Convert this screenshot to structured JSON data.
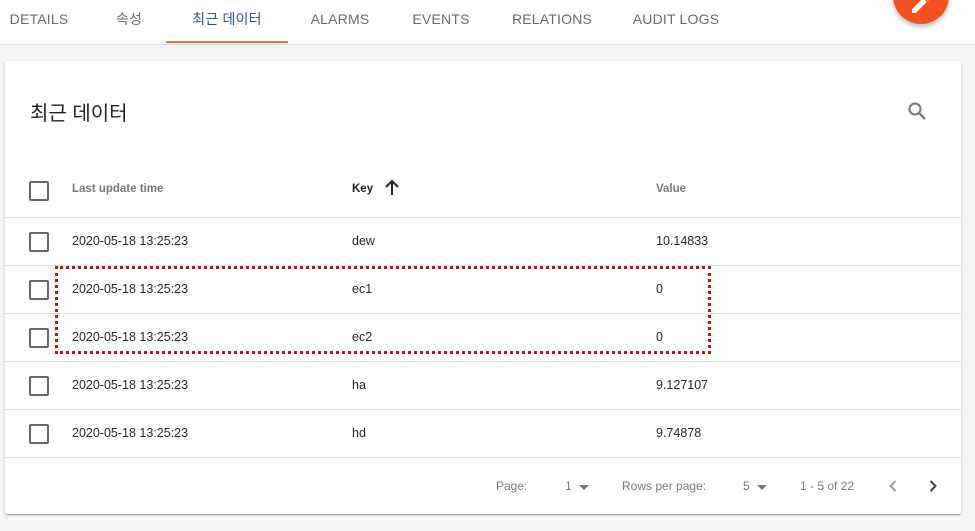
{
  "tabs": [
    {
      "label": "DETAILS"
    },
    {
      "label": "속성"
    },
    {
      "label": "최근 데이터",
      "active": true
    },
    {
      "label": "ALARMS"
    },
    {
      "label": "EVENTS"
    },
    {
      "label": "RELATIONS"
    },
    {
      "label": "AUDIT LOGS"
    }
  ],
  "colors": {
    "accent": "#f4511e",
    "active_tab": "#305680",
    "ink": "#e0764a",
    "highlight": "#b01818"
  },
  "card": {
    "title": "최근 데이터"
  },
  "table": {
    "columns": {
      "time": "Last update time",
      "key": "Key",
      "value": "Value"
    },
    "sort": {
      "column": "key",
      "direction": "ascending"
    },
    "rows": [
      {
        "time": "2020-05-18 13:25:23",
        "key": "dew",
        "value": "10.14833"
      },
      {
        "time": "2020-05-18 13:25:23",
        "key": "ec1",
        "value": "0"
      },
      {
        "time": "2020-05-18 13:25:23",
        "key": "ec2",
        "value": "0"
      },
      {
        "time": "2020-05-18 13:25:23",
        "key": "ha",
        "value": "9.127107"
      },
      {
        "time": "2020-05-18 13:25:23",
        "key": "hd",
        "value": "9.74878"
      }
    ]
  },
  "paginator": {
    "page_label": "Page:",
    "page_value": "1",
    "rows_label": "Rows per page:",
    "rows_value": "5",
    "range": "1 - 5 of 22"
  }
}
